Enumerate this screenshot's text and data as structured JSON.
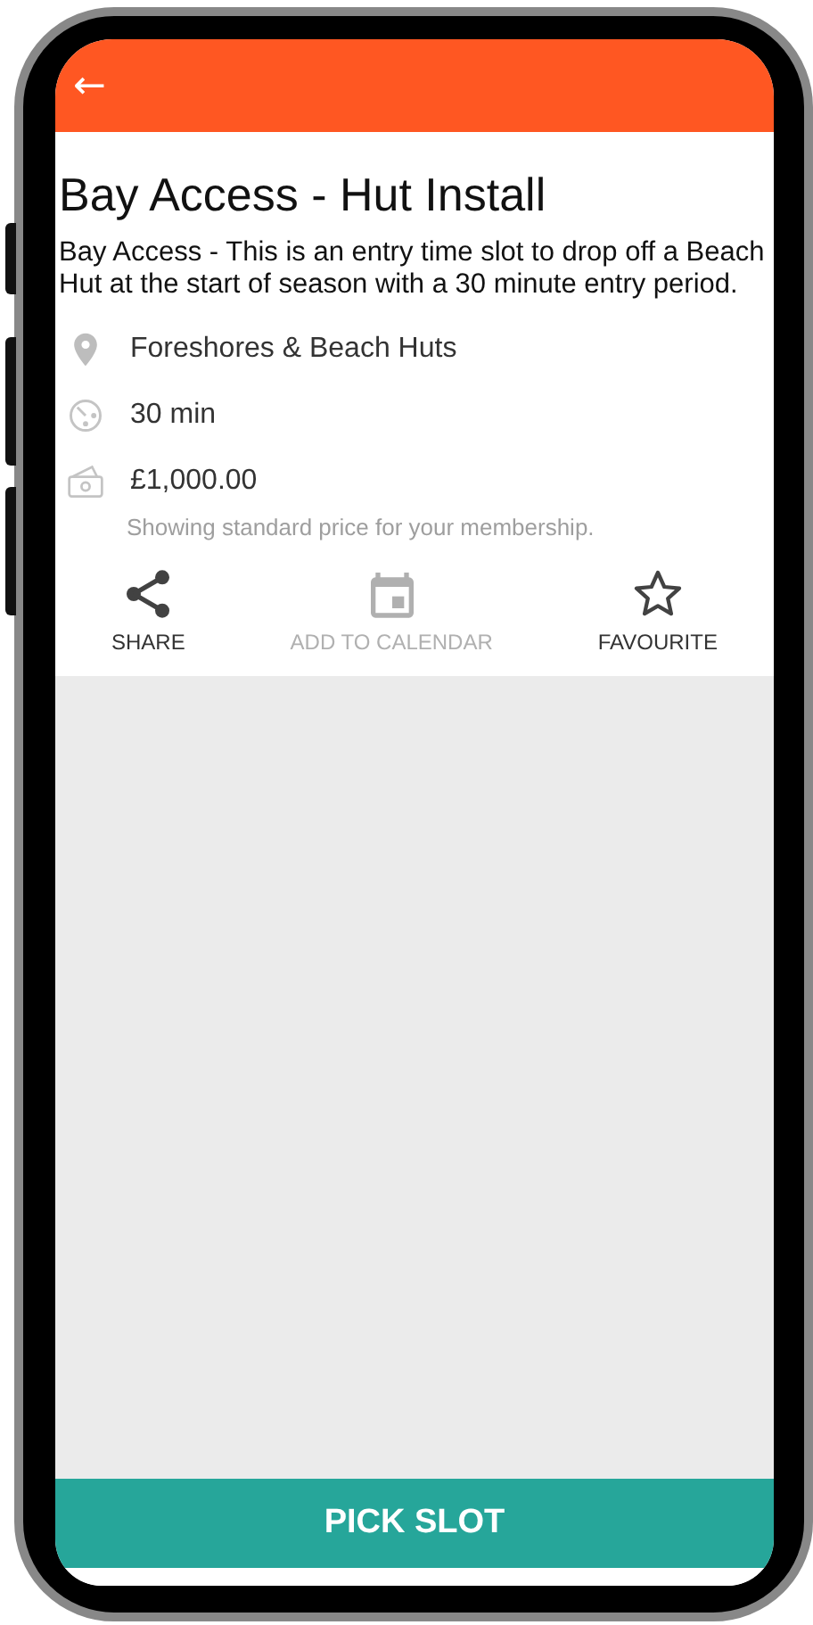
{
  "header": {
    "back": "←"
  },
  "title": "Bay Access - Hut Install",
  "description": "Bay Access - This is an entry time slot to drop off a Beach Hut at the start of season with a 30 minute entry period.",
  "details": [
    {
      "kind": "location",
      "text": "Foreshores & Beach Huts"
    },
    {
      "kind": "duration",
      "text": "30 min"
    },
    {
      "kind": "price",
      "text": "£1,000.00"
    }
  ],
  "price_note": "Showing standard price for your membership.",
  "actions": [
    {
      "kind": "share",
      "label": "SHARE",
      "disabled": false
    },
    {
      "kind": "calendar",
      "label": "ADD TO CALENDAR",
      "disabled": true
    },
    {
      "kind": "favourite",
      "label": "FAVOURITE",
      "disabled": false
    }
  ],
  "primary_button": "PICK SLOT"
}
